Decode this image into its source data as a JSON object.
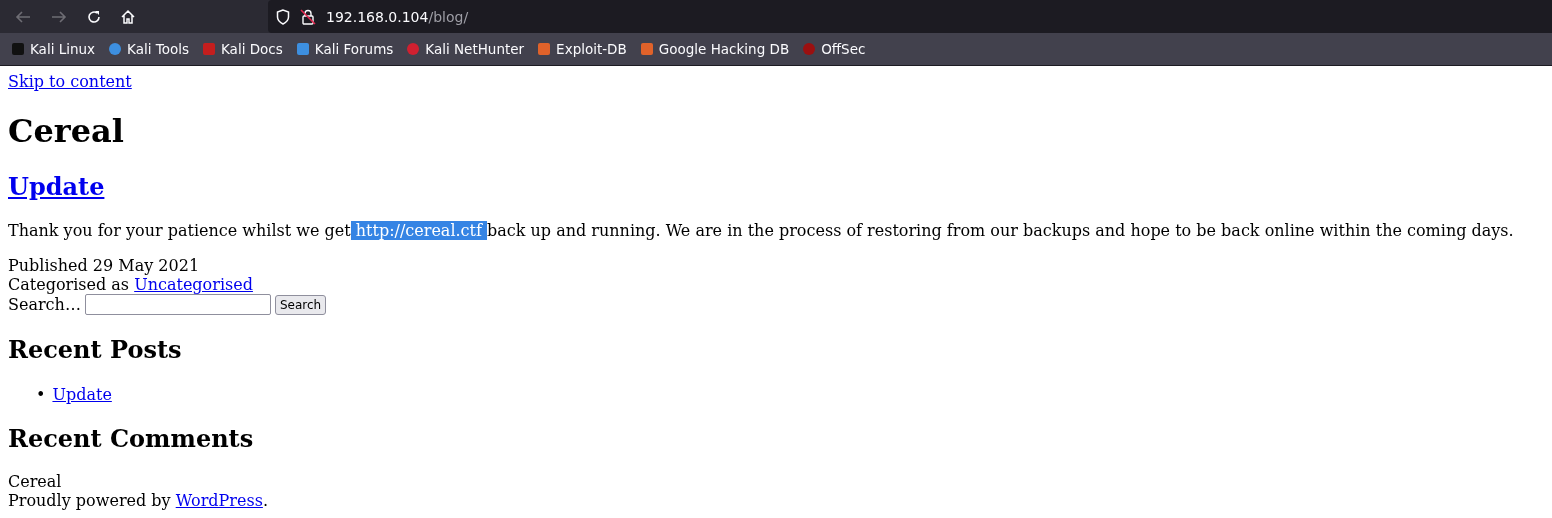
{
  "toolbar": {
    "url_host": "192.168.0.104",
    "url_path": "/blog/"
  },
  "bookmarks": [
    {
      "label": "Kali Linux",
      "color": "#111111"
    },
    {
      "label": "Kali Tools",
      "color": "#3d8fe0"
    },
    {
      "label": "Kali Docs",
      "color": "#c41e1e"
    },
    {
      "label": "Kali Forums",
      "color": "#3d8fe0"
    },
    {
      "label": "Kali NetHunter",
      "color": "#d02030"
    },
    {
      "label": "Exploit-DB",
      "color": "#e0622a"
    },
    {
      "label": "Google Hacking DB",
      "color": "#e0622a"
    },
    {
      "label": "OffSec",
      "color": "#9b1010"
    }
  ],
  "page": {
    "skip_link": "Skip to content",
    "site_title": "Cereal",
    "post": {
      "title": "Update",
      "text_before": "Thank you for your patience whilst we get",
      "highlighted_text": " http://cereal.ctf ",
      "text_after": "back up and running. We are in the process of restoring from our backups and hope to be back online within the coming days.",
      "published": "Published 29 May 2021",
      "category_label": "Categorised as",
      "category": "Uncategorised"
    },
    "search": {
      "label": "Search…",
      "button": "Search"
    },
    "recent_posts": {
      "heading": "Recent Posts",
      "items": [
        {
          "marker": "•",
          "label": "Update"
        }
      ]
    },
    "recent_comments": {
      "heading": "Recent Comments"
    },
    "footer": {
      "site": "Cereal",
      "powered_before": "Proudly powered by",
      "powered_link": "WordPress",
      "powered_after": "."
    }
  }
}
